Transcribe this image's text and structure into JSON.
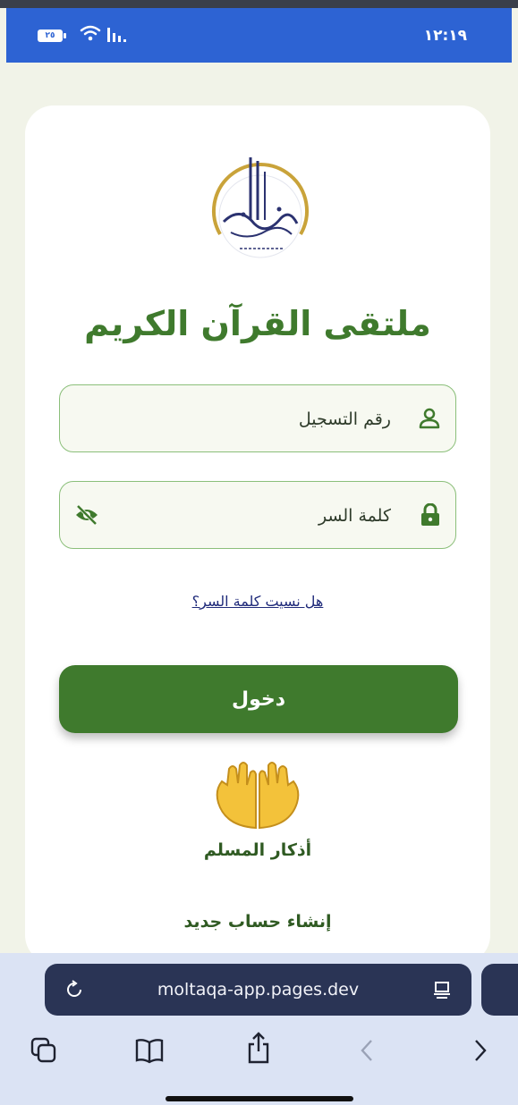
{
  "status_bar": {
    "time": "١٢:١٩",
    "battery": "٢٥"
  },
  "login": {
    "title": "ملتقى القرآن الكريم",
    "registration_placeholder": "رقم التسجيل",
    "password_placeholder": "كلمة السر",
    "forgot_password": "هل نسيت كلمة السر؟",
    "login_button": "دخول",
    "adhkar_label": "أذكار المسلم",
    "register_link": "إنشاء حساب جديد"
  },
  "browser": {
    "url": "moltaqa-app.pages.dev"
  },
  "icons": {
    "reload": "reload-icon",
    "reader": "reader-mode-icon",
    "tabs": "tabs-icon",
    "bookmarks": "bookmarks-icon",
    "share": "share-icon",
    "back": "back-icon",
    "forward": "forward-icon"
  },
  "colors": {
    "brand_green": "#3f7a2d",
    "status_bar_blue": "#2d63d3",
    "url_bar": "#2a3455"
  }
}
